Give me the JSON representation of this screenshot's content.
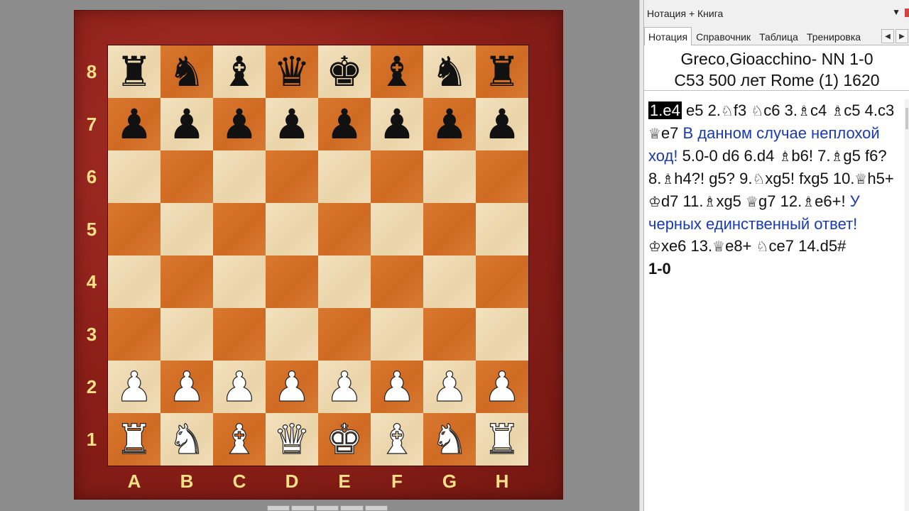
{
  "board": {
    "ranks": [
      "8",
      "7",
      "6",
      "5",
      "4",
      "3",
      "2",
      "1"
    ],
    "files": [
      "A",
      "B",
      "C",
      "D",
      "E",
      "F",
      "G",
      "H"
    ],
    "position": [
      [
        "r",
        "n",
        "b",
        "q",
        "k",
        "b",
        "n",
        "r"
      ],
      [
        "p",
        "p",
        "p",
        "p",
        "p",
        "p",
        "p",
        "p"
      ],
      [
        "",
        "",
        "",
        "",
        "",
        "",
        "",
        ""
      ],
      [
        "",
        "",
        "",
        "",
        "",
        "",
        "",
        ""
      ],
      [
        "",
        "",
        "",
        "",
        "",
        "",
        "",
        ""
      ],
      [
        "",
        "",
        "",
        "",
        "",
        "",
        "",
        ""
      ],
      [
        "P",
        "P",
        "P",
        "P",
        "P",
        "P",
        "P",
        "P"
      ],
      [
        "R",
        "N",
        "B",
        "Q",
        "K",
        "B",
        "N",
        "R"
      ]
    ],
    "colors": {
      "light_square": "#f0dfb9",
      "dark_square": "#d4712a",
      "frame": "#8e2019",
      "label": "#f6e08a"
    }
  },
  "panel": {
    "title": "Нотация + Книга",
    "tabs": [
      "Нотация",
      "Справочник",
      "Таблица",
      "Тренировка"
    ],
    "active_tab": "Нотация",
    "game": {
      "players": "Greco,Gioacchino- NN  1-0",
      "event": "C53 500 лет Rome (1) 1620"
    },
    "notation": [
      {
        "t": "1.e4",
        "current": true
      },
      {
        "t": "e5"
      },
      {
        "t": "2.",
        "p": "♘",
        "m": "f3"
      },
      {
        "p": "♘",
        "m": "c6"
      },
      {
        "t": "3.",
        "p": "♗",
        "m": "c4"
      },
      {
        "p": "♗",
        "m": "c5"
      },
      {
        "t": "4.c3"
      },
      {
        "p": "♕",
        "m": "e7"
      },
      {
        "comment": "В данном случае неплохой ход!"
      },
      {
        "t": "5.0-0"
      },
      {
        "t": "d6"
      },
      {
        "t": "6.d4"
      },
      {
        "p": "♗",
        "m": "b6!"
      },
      {
        "t": "7.",
        "p": "♗",
        "m": "g5"
      },
      {
        "t": "f6?"
      },
      {
        "t": "8.",
        "p": "♗",
        "m": "h4?!"
      },
      {
        "t": "g5?"
      },
      {
        "t": "9.",
        "p": "♘",
        "m": "xg5!"
      },
      {
        "t": "fxg5"
      },
      {
        "t": "10.",
        "p": "♕",
        "m": "h5+"
      },
      {
        "p": "♔",
        "m": "d7"
      },
      {
        "t": "11.",
        "p": "♗",
        "m": "xg5"
      },
      {
        "p": "♕",
        "m": "g7"
      },
      {
        "t": "12.",
        "p": "♗",
        "m": "e6+!"
      },
      {
        "comment": "У черных единственный ответ!"
      },
      {
        "p": "♔",
        "m": "xe6"
      },
      {
        "t": "13.",
        "p": "♕",
        "m": "e8+"
      },
      {
        "p": "♘",
        "m": "ce7"
      },
      {
        "t": "14.d5#"
      }
    ],
    "result": "1-0"
  }
}
